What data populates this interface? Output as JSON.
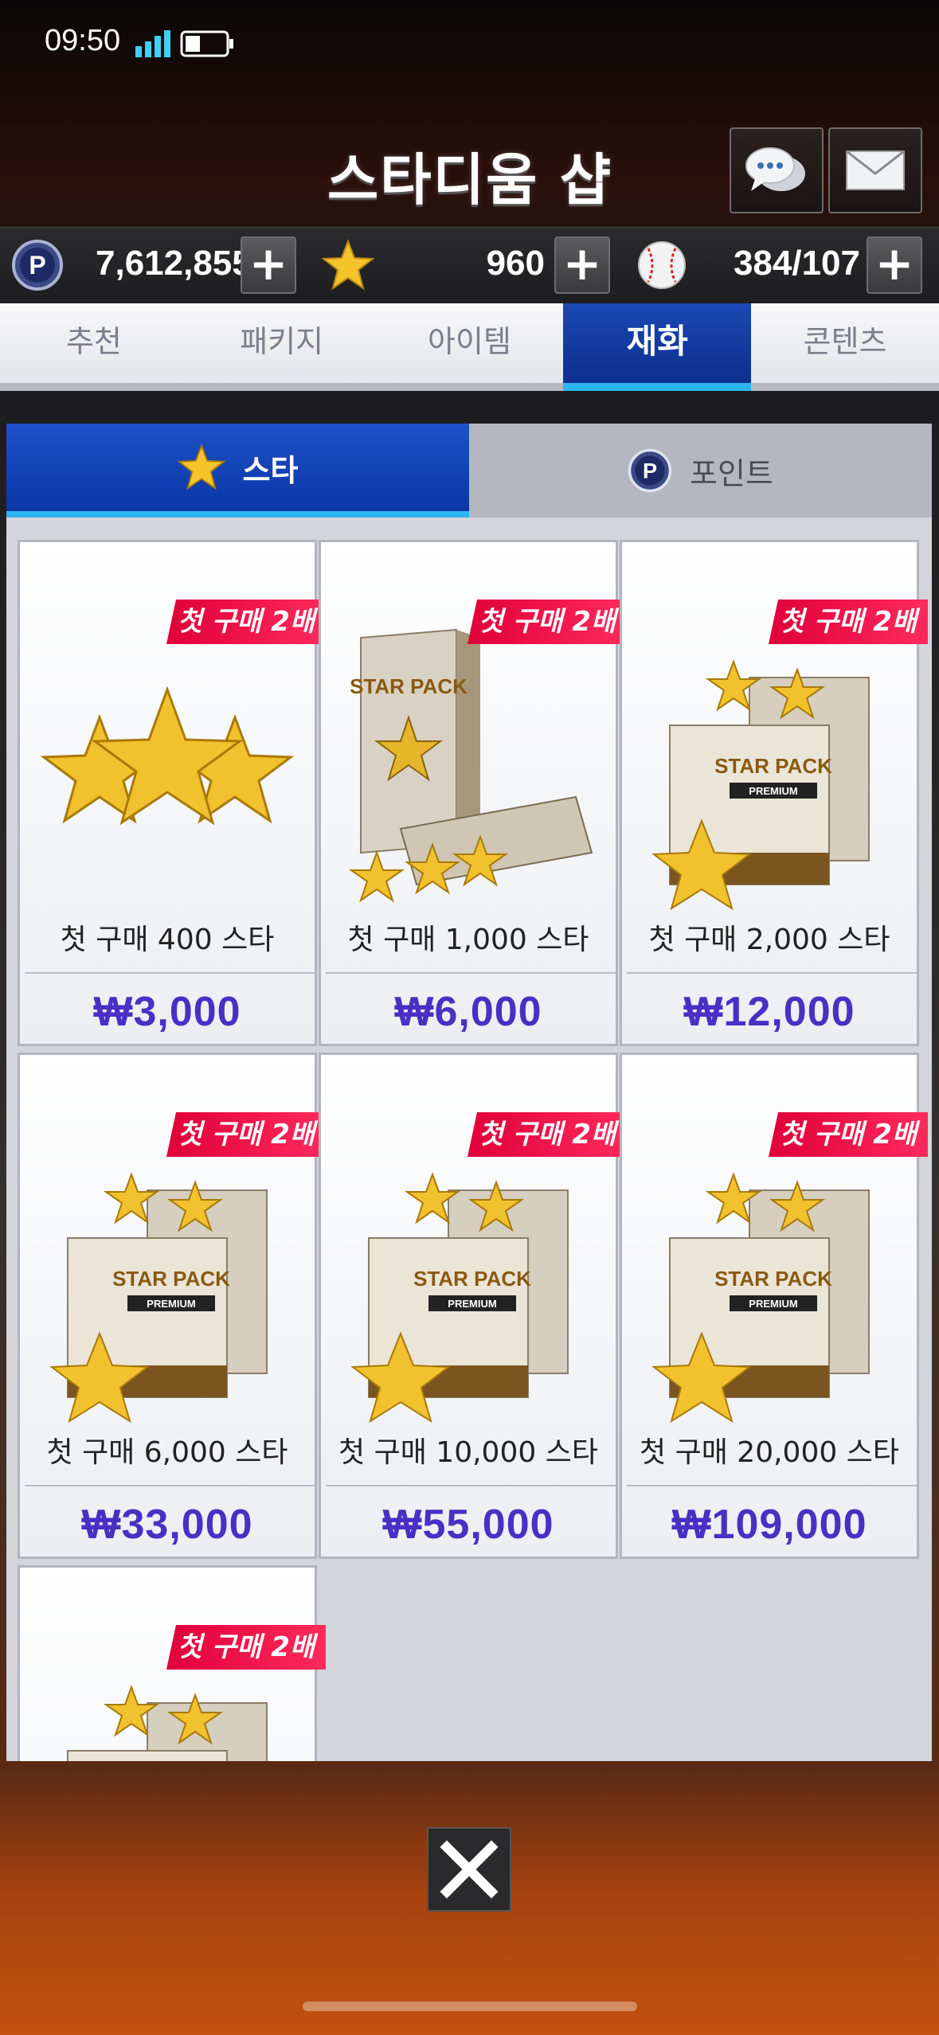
{
  "status_bar": {
    "time": "09:50"
  },
  "header": {
    "title": "스타디움 샵",
    "chat_icon": "chat-bubble-icon",
    "mail_icon": "envelope-icon"
  },
  "currency": {
    "points": "7,612,855",
    "stars": "960",
    "balls": "384/107",
    "plus": "+"
  },
  "main_tabs": [
    {
      "label": "추천"
    },
    {
      "label": "패키지"
    },
    {
      "label": "아이템"
    },
    {
      "label": "재화",
      "active": true
    },
    {
      "label": "콘텐츠"
    }
  ],
  "sub_tabs": [
    {
      "label": "스타",
      "icon": "star-icon",
      "active": true
    },
    {
      "label": "포인트",
      "icon": "p-coin-icon"
    }
  ],
  "badge_text": "첫 구매 2배",
  "products": [
    {
      "name": "첫 구매 400 스타",
      "price": "₩3,000"
    },
    {
      "name": "첫 구매 1,000 스타",
      "price": "₩6,000"
    },
    {
      "name": "첫 구매 2,000 스타",
      "price": "₩12,000"
    },
    {
      "name": "첫 구매 6,000 스타",
      "price": "₩33,000"
    },
    {
      "name": "첫 구매 10,000 스타",
      "price": "₩55,000"
    },
    {
      "name": "첫 구매 20,000 스타",
      "price": "₩109,000"
    },
    {
      "name": "",
      "price": ""
    }
  ],
  "pack_art": {
    "brand": "STAR PACK",
    "tier": "PREMIUM"
  },
  "close_icon": "close-x-icon",
  "colors": {
    "accent_blue": "#0c2f8f",
    "tab_highlight": "#2bb4f2",
    "badge_red": "#e0003a",
    "price_purple": "#4a2fc4"
  }
}
